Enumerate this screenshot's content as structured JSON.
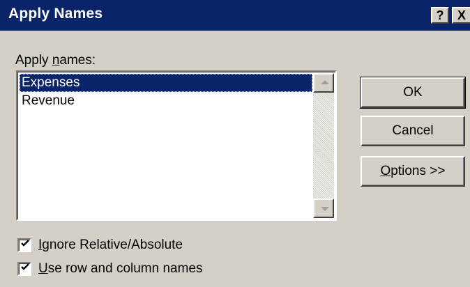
{
  "dialog": {
    "title": "Apply Names",
    "help_glyph": "?",
    "close_glyph": "X"
  },
  "apply_names": {
    "label_before": "Apply ",
    "label_accel": "n",
    "label_after": "ames:",
    "items": [
      {
        "label": "Expenses",
        "selected": true
      },
      {
        "label": "Revenue",
        "selected": false
      }
    ]
  },
  "buttons": {
    "ok": "OK",
    "cancel": "Cancel",
    "options_accel": "O",
    "options_rest": "ptions >>"
  },
  "options": {
    "ignore_relative_absolute": {
      "accel": "I",
      "rest": "gnore Relative/Absolute",
      "checked": true
    },
    "use_row_column_names": {
      "accel": "U",
      "rest": "se row and column names",
      "checked": true
    }
  },
  "colors": {
    "titlebar": "#0a246a",
    "selection": "#0a246a",
    "face": "#d4d0c8"
  }
}
